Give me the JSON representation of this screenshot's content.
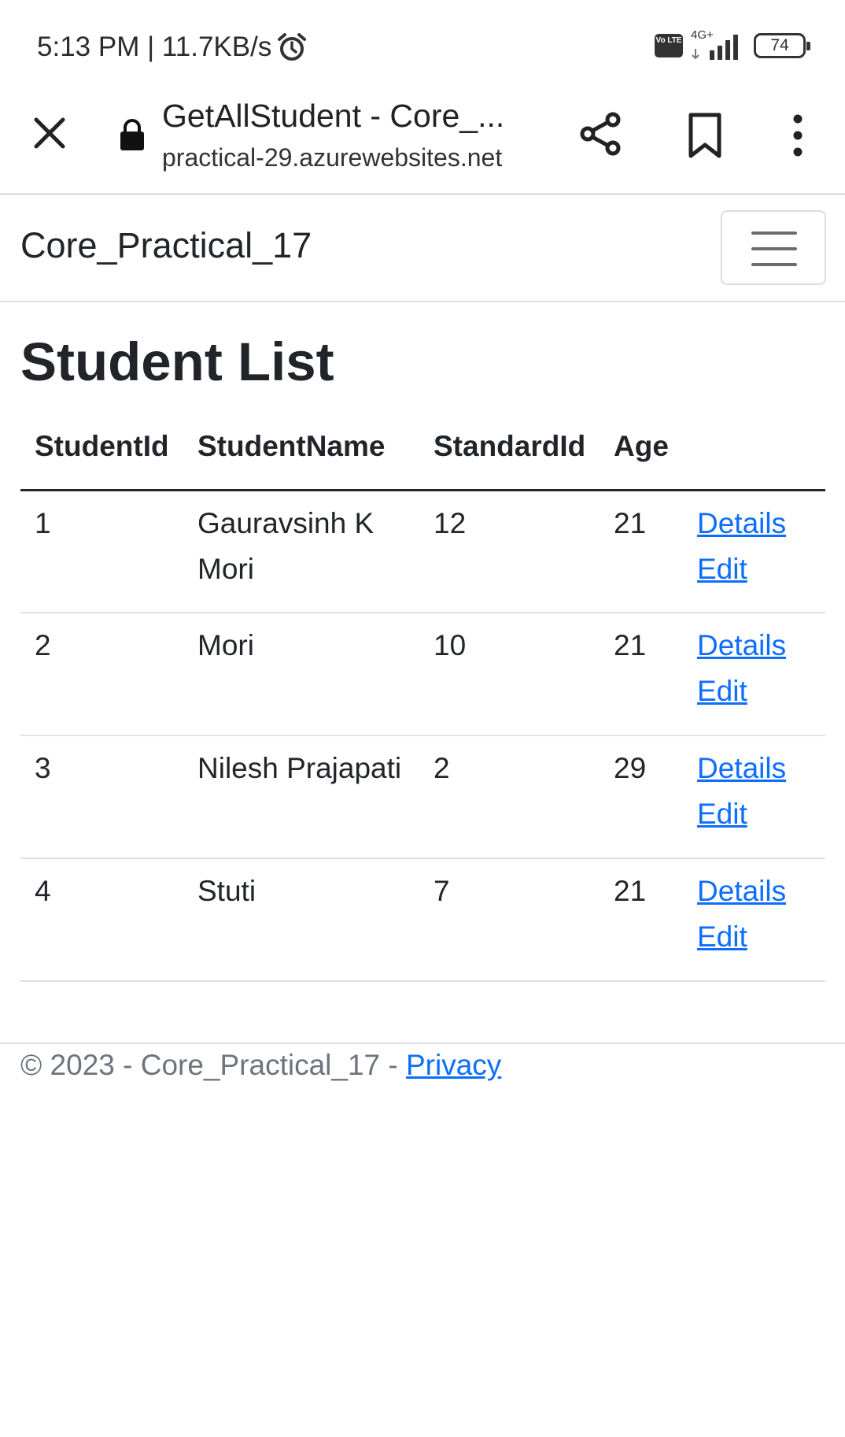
{
  "status_bar": {
    "time": "5:13 PM | 11.7KB/s",
    "volte": "Vo LTE",
    "network": "4G+",
    "battery": "74"
  },
  "browser": {
    "page_title": "GetAllStudent - Core_...",
    "url": "practical-29.azurewebsites.net"
  },
  "navbar": {
    "brand": "Core_Practical_17"
  },
  "main": {
    "heading": "Student List",
    "table": {
      "headers": [
        "StudentId",
        "StudentName",
        "StandardId",
        "Age"
      ],
      "rows": [
        {
          "id": "1",
          "name": "Gauravsinh K Mori",
          "standard": "12",
          "age": "21",
          "details": "Details",
          "edit": "Edit"
        },
        {
          "id": "2",
          "name": "Mori",
          "standard": "10",
          "age": "21",
          "details": "Details",
          "edit": "Edit"
        },
        {
          "id": "3",
          "name": "Nilesh Prajapati",
          "standard": "2",
          "age": "29",
          "details": "Details",
          "edit": "Edit"
        },
        {
          "id": "4",
          "name": "Stuti",
          "standard": "7",
          "age": "21",
          "details": "Details",
          "edit": "Edit"
        }
      ]
    }
  },
  "footer": {
    "text": "© 2023 - Core_Practical_17 - ",
    "privacy_link": "Privacy"
  },
  "colors": {
    "link": "#0d6efd",
    "text": "#212529",
    "muted": "#6c757d",
    "border": "#dee2e6"
  }
}
